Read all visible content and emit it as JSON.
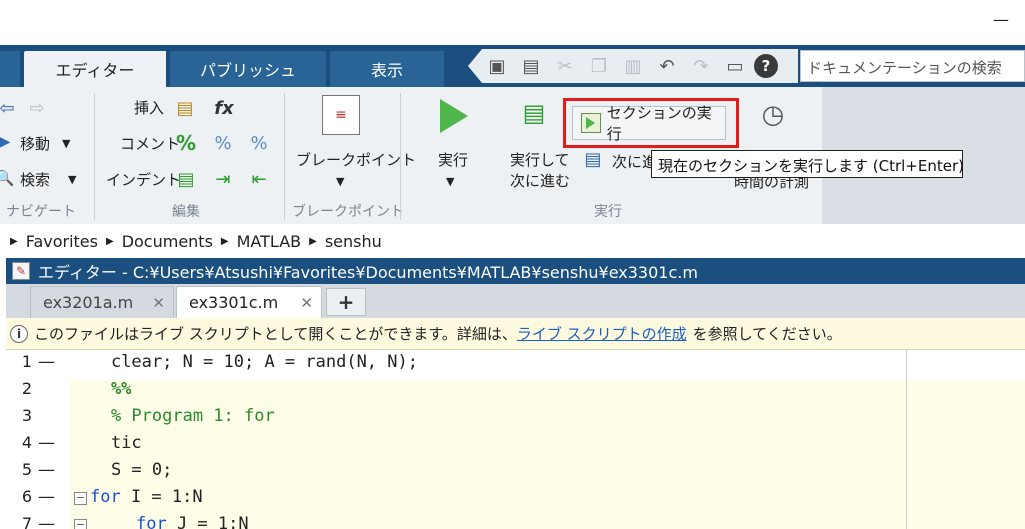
{
  "window": {
    "minimize_glyph": "—"
  },
  "tabs": [
    {
      "label": "エディター"
    },
    {
      "label": "パブリッシュ"
    },
    {
      "label": "表示"
    }
  ],
  "quick_access": [
    "new-icon",
    "save-icon",
    "cut-icon",
    "copy-icon",
    "paste-icon",
    "undo-icon",
    "redo-icon",
    "switch-window-icon",
    "help-icon"
  ],
  "help_glyph": "?",
  "search": {
    "placeholder": "ドキュメンテーションの検索"
  },
  "ribbon": {
    "navigate": {
      "title": "ナビゲート",
      "move": "移動",
      "find": "検索"
    },
    "edit": {
      "title": "編集",
      "insert": "挿入",
      "comment": "コメント",
      "indent": "インデント",
      "fx": "fx",
      "percent": "%"
    },
    "breakpoint": {
      "title": "ブレークポイント",
      "button": "ブレークポイント"
    },
    "run": {
      "title": "実行",
      "run": "実行",
      "run_advance_1": "実行して",
      "run_advance_2": "次に進む",
      "run_section": "セクションの実行",
      "advance": "次に進",
      "timing": "時間の計測"
    }
  },
  "tooltip": "現在のセクションを実行します (Ctrl+Enter)",
  "breadcrumb": [
    "Favorites",
    "Documents",
    "MATLAB",
    "senshu"
  ],
  "editor": {
    "title": "エディター - C:¥Users¥Atsushi¥Favorites¥Documents¥MATLAB¥senshu¥ex3301c.m",
    "tabs": [
      {
        "label": "ex3201a.m"
      },
      {
        "label": "ex3301c.m"
      }
    ],
    "info": {
      "before": "このファイルはライブ スクリプトとして開くことができます。詳細は、",
      "link": "ライブ スクリプトの作成",
      "after": "を参照してください。"
    },
    "lines": [
      {
        "n": "1",
        "dash": "—",
        "text": "    clear; N = 10; A = rand(N, N);"
      },
      {
        "n": "2",
        "dash": "",
        "text": "    %%"
      },
      {
        "n": "3",
        "dash": "",
        "text": "    % Program 1: for"
      },
      {
        "n": "4",
        "dash": "—",
        "text": "    tic"
      },
      {
        "n": "5",
        "dash": "—",
        "text": "    S = 0;"
      },
      {
        "n": "6",
        "dash": "—",
        "kw": "for",
        "text": " I = 1:N"
      },
      {
        "n": "7",
        "dash": "—",
        "kw": "for",
        "text": " J = 1:N"
      }
    ]
  },
  "colors": {
    "titlebar_blue": "#1b4f7f",
    "highlight_red": "#e21b1b",
    "run_green": "#4fb64b",
    "link_blue": "#1a5fc0"
  }
}
